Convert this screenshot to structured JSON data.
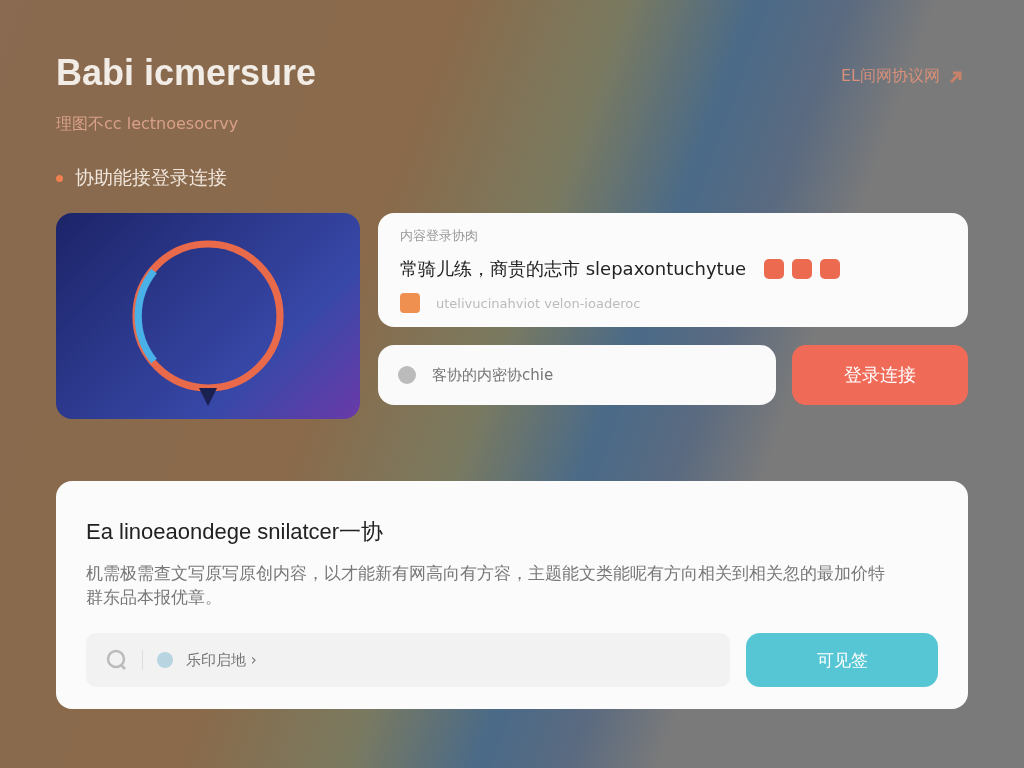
{
  "header": {
    "title": "Babi icmersure",
    "subtitle": "理图不cc lectnoesocrvy",
    "top_link": "EL间网协议网"
  },
  "section_label": "协助能接登录连接",
  "link_card": {
    "label": "内容登录协肉",
    "text": "常骑儿练，商贵的志市 slepaxontuchytue",
    "source": "utelivucinahviot velon-ioaderoc"
  },
  "link_input": {
    "placeholder": "客协的内密协chie"
  },
  "connect_button": "登录连接",
  "info_card": {
    "heading": "Ea linoeaondege snilatcer一协",
    "body": "机需极需查文写原写原创内容，以才能新有网高向有方容，主题能文类能呢有方向相关到相关忽的最加价特群东品本报优章。",
    "search": {
      "placeholder": "乐印启地 ›"
    },
    "button": "可见签"
  }
}
